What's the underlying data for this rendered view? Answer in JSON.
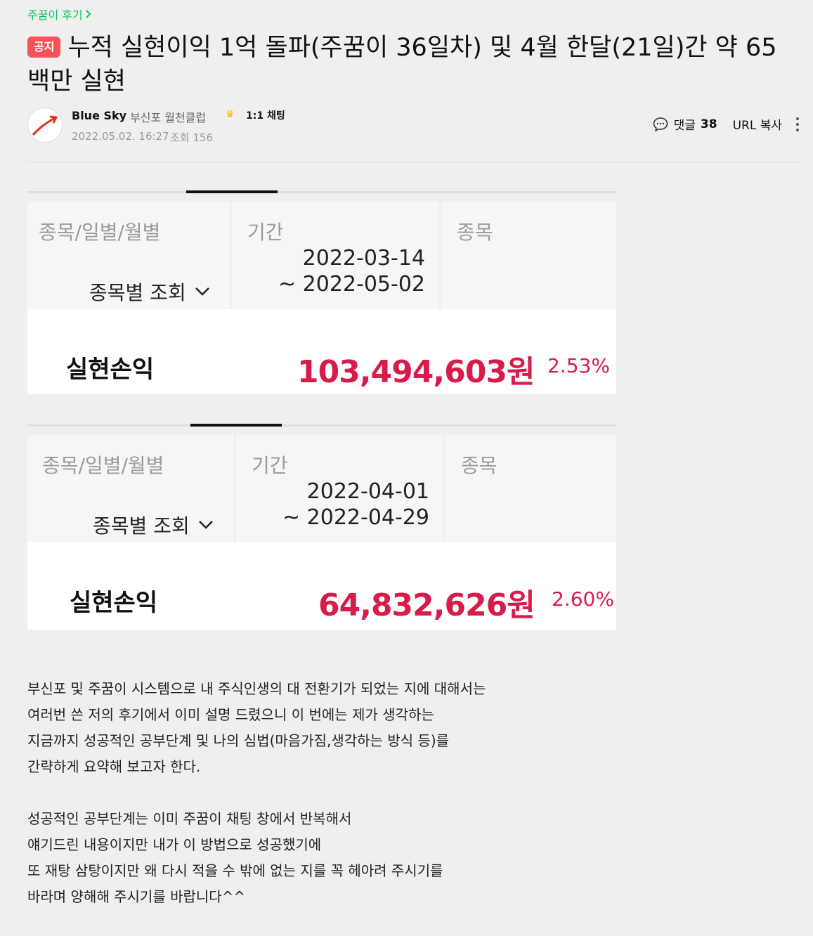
{
  "board": {
    "label": "주꿈이 후기",
    "chevron_icon": "chevron-right-icon"
  },
  "post": {
    "badge": "공지",
    "title": "누적 실현이익 1억 돌파(주꿈이 36일차) 및 4월 한달(21일)간 약 65백만 실현"
  },
  "author": {
    "name": "Blue Sky",
    "grade": "부신포 월천클럽",
    "chat": "1:1 채팅",
    "date": "2022.05.02. 16:27",
    "views": "조회 156"
  },
  "actions": {
    "comment_label": "댓글",
    "comment_count": "38",
    "url_copy": "URL 복사"
  },
  "cards": [
    {
      "col1_label": "종목/일별/월별",
      "col1_value": "종목별 조회",
      "col2_label": "기간",
      "range_start": "2022-03-14",
      "range_end": "~ 2022-05-02",
      "col3_label": "종목",
      "result_label": "실현손익",
      "result_amount": "103,494,603원",
      "result_pct": "2.53%"
    },
    {
      "col1_label": "종목/일별/월별",
      "col1_value": "종목별 조회",
      "col2_label": "기간",
      "range_start": "2022-04-01",
      "range_end": "~ 2022-04-29",
      "col3_label": "종목",
      "result_label": "실현손익",
      "result_amount": "64,832,626원",
      "result_pct": "2.60%"
    }
  ],
  "body": {
    "para1": [
      "부신포 및 주꿈이 시스템으로 내 주식인생의 대 전환기가 되었는 지에 대해서는",
      "여러번 쓴 저의 후기에서 이미 설명 드렸으니 이 번에는 제가 생각하는",
      "지금까지 성공적인 공부단계 및 나의 심법(마음가짐,생각하는 방식 등)를",
      "간략하게 요약해 보고자 한다."
    ],
    "para2": [
      "성공적인 공부단계는 이미 주꿈이 채팅 창에서 반복해서",
      "얘기드린 내용이지만 내가 이 방법으로 성공했기에",
      "또 재탕 삼탕이지만 왜 다시 적을 수 밖에 없는 지를 꼭 헤아려 주시기를",
      "바라며 양해해 주시기를 바랍니다^^"
    ]
  }
}
